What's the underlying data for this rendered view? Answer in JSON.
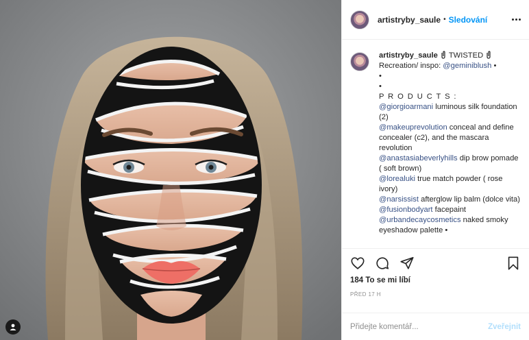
{
  "header": {
    "username": "artistryby_saule",
    "separator": "•",
    "follow_label": "Sledování"
  },
  "caption": {
    "username": "artistryby_saule",
    "title": "TWISTED",
    "line1_text": "Recreation/ inspo: ",
    "line1_mention": "@geminiblush",
    "bullet": "•",
    "products_heading": "P R O D U C T S :",
    "products": [
      {
        "mention": "@giorgioarmani",
        "text": " luminous silk foundation (2)"
      },
      {
        "mention": "@makeuprevolution",
        "text": " conceal and define concealer (c2), and the mascara revolution"
      },
      {
        "mention": "@anastasiabeverlyhills",
        "text": " dip brow pomade ( soft brown)"
      },
      {
        "mention": "@lorealuki",
        "text": " true match powder ( rose ivory)"
      },
      {
        "mention": "@narsissist",
        "text": " afterglow lip balm (dolce vita)"
      },
      {
        "mention": "@fusionbodyart",
        "text": " facepaint"
      },
      {
        "mention": "@urbandecaycosmetics",
        "text": " naked smoky eyeshadow palette •"
      }
    ]
  },
  "actions": {
    "icons": [
      "heart-icon",
      "comment-icon",
      "share-icon",
      "bookmark-icon"
    ]
  },
  "likes": "184 To se mi líbí",
  "timestamp": "PŘED 17 H",
  "comment": {
    "placeholder": "Přidejte komentář...",
    "post_label": "Zveřejnit"
  },
  "colors": {
    "link": "#385185",
    "follow": "#0095f6",
    "post_disabled": "#b2dffc",
    "muted": "#8e8e8e"
  }
}
